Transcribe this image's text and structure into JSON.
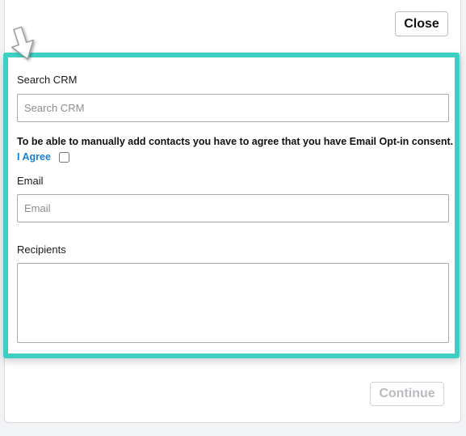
{
  "dialog": {
    "close_label": "Close",
    "continue_label": "Continue"
  },
  "form": {
    "search_crm": {
      "label": "Search CRM",
      "placeholder": "Search CRM",
      "value": ""
    },
    "consent": {
      "text": "To be able to manually add contacts you have to agree that you have Email Opt-in consent.",
      "agree_label": "I Agree",
      "checked": false
    },
    "email": {
      "label": "Email",
      "placeholder": "Email",
      "value": ""
    },
    "recipients": {
      "label": "Recipients",
      "value": ""
    }
  },
  "colors": {
    "highlight_frame": "#3dcfc3",
    "agree_link": "#1b7fd6",
    "continue_disabled_text": "#b8bbc0"
  },
  "icons": {
    "pointer": "down-arrow-pointer-icon"
  }
}
